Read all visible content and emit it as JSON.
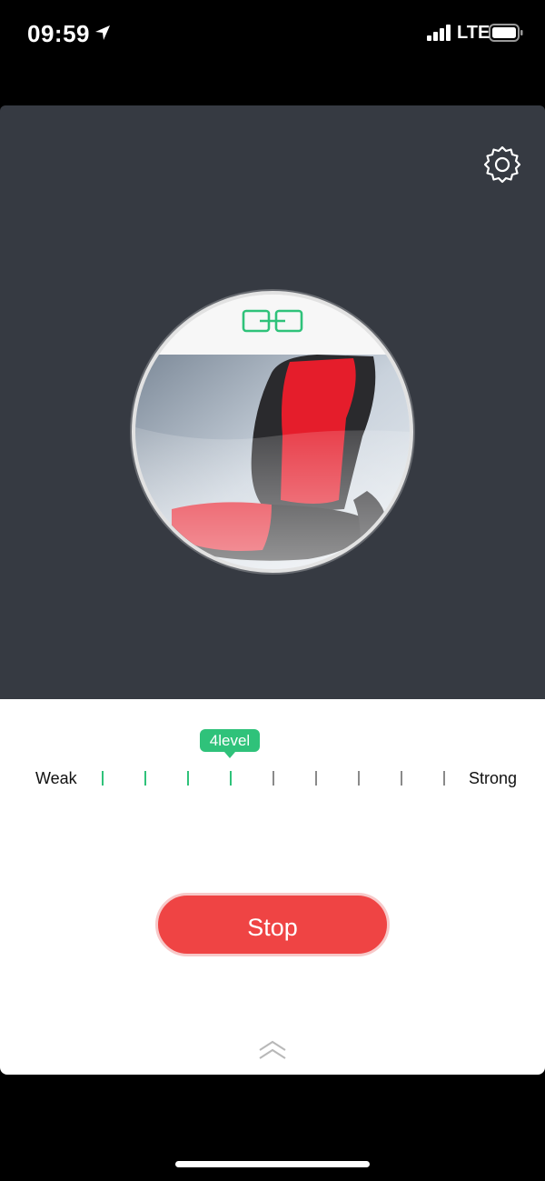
{
  "status_bar": {
    "time": "09:59",
    "network": "LTE",
    "icons": [
      "location-arrow-icon",
      "signal-icon",
      "battery-icon"
    ]
  },
  "header": {
    "settings_icon": "gear-icon"
  },
  "device": {
    "connection_icon": "link-icon",
    "image": "red heated car seat"
  },
  "intensity": {
    "min_label": "Weak",
    "max_label": "Strong",
    "current_level_label": "4level",
    "current_level": 4,
    "total_levels": 9
  },
  "actions": {
    "stop_label": "Stop",
    "expand_icon": "double-chevron-up-icon"
  },
  "colors": {
    "accent": "#2fc27a",
    "stop": "#ef4444",
    "panel": "#363a42"
  }
}
